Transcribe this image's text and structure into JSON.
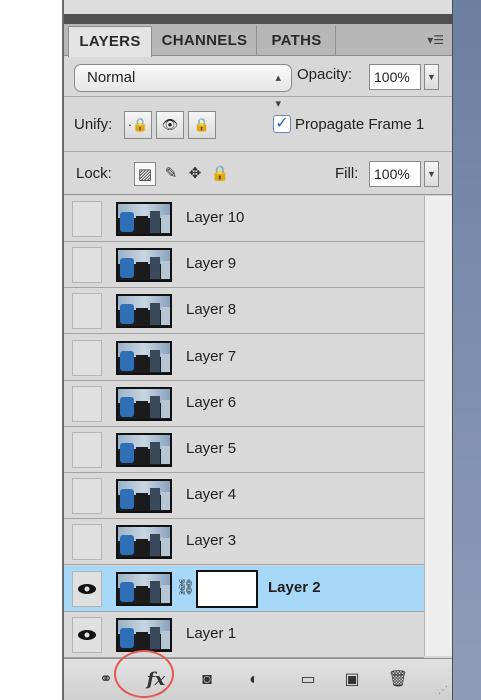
{
  "tabs": [
    "LAYERS",
    "CHANNELS",
    "PATHS"
  ],
  "blend": {
    "mode": "Normal",
    "opacity_label": "Opacity:",
    "opacity_value": "100%"
  },
  "unify": {
    "label": "Unify:",
    "propagate_label": "Propagate Frame 1",
    "propagate_checked": true
  },
  "lock": {
    "label": "Lock:",
    "fill_label": "Fill:",
    "fill_value": "100%"
  },
  "layers": [
    {
      "name": "Layer 10",
      "visible": false,
      "selected": false
    },
    {
      "name": "Layer 9",
      "visible": false,
      "selected": false
    },
    {
      "name": "Layer 8",
      "visible": false,
      "selected": false
    },
    {
      "name": "Layer 7",
      "visible": false,
      "selected": false
    },
    {
      "name": "Layer 6",
      "visible": false,
      "selected": false
    },
    {
      "name": "Layer 5",
      "visible": false,
      "selected": false
    },
    {
      "name": "Layer 4",
      "visible": false,
      "selected": false
    },
    {
      "name": "Layer 3",
      "visible": false,
      "selected": false
    },
    {
      "name": "Layer 2",
      "visible": true,
      "selected": true,
      "has_mask": true
    },
    {
      "name": "Layer 1",
      "visible": true,
      "selected": false
    }
  ],
  "colors": {
    "selected_row": "#a8d8f7",
    "annotation_circle": "#e5564f"
  },
  "bottom_icons": [
    "link-layers-icon",
    "layer-style-fx-icon",
    "add-layer-mask-icon",
    "adjustment-layer-icon",
    "new-group-icon",
    "new-layer-icon",
    "trash-icon"
  ]
}
